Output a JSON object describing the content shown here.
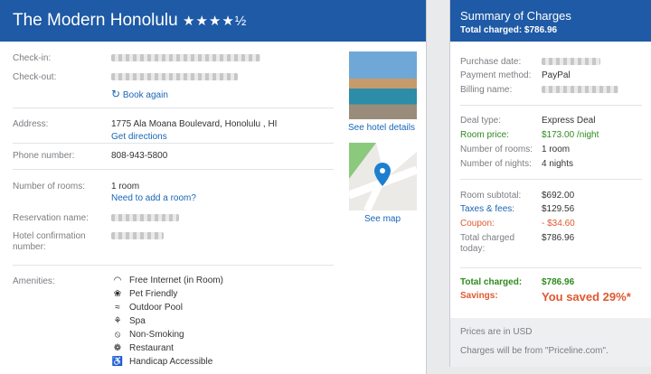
{
  "hotel": {
    "name": "The Modern Honolulu",
    "stars": "★★★★½"
  },
  "left": {
    "checkin_label": "Check-in:",
    "checkout_label": "Check-out:",
    "book_again": "Book again",
    "address_label": "Address:",
    "address": "1775 Ala Moana Boulevard, Honolulu , HI",
    "directions": "Get directions",
    "phone_label": "Phone number:",
    "phone": "808-943-5800",
    "rooms_label": "Number of rooms:",
    "rooms": "1 room",
    "add_room": "Need to add a room?",
    "reservation_label": "Reservation name:",
    "confirmation_label": "Hotel confirmation number:",
    "amenities_label": "Amenities:",
    "amenities": [
      "Free Internet (in Room)",
      "Pet Friendly",
      "Outdoor Pool",
      "Spa",
      "Non-Smoking",
      "Restaurant",
      "Handicap Accessible"
    ],
    "see_details": "See hotel details",
    "see_map": "See map"
  },
  "summary": {
    "title": "Summary of Charges",
    "total_head": "Total charged: $786.96",
    "purchase_label": "Purchase date:",
    "payment_label": "Payment method:",
    "payment": "PayPal",
    "billing_label": "Billing name:",
    "deal_label": "Deal type:",
    "deal": "Express Deal",
    "room_price_label": "Room price:",
    "room_price": "$173.00 /night",
    "num_rooms_label": "Number of rooms:",
    "num_rooms": "1 room",
    "nights_label": "Number of nights:",
    "nights": "4 nights",
    "subtotal_label": "Room subtotal:",
    "subtotal": "$692.00",
    "taxes_label": "Taxes & fees:",
    "taxes": "$129.56",
    "coupon_label": "Coupon:",
    "coupon": "- $34.60",
    "total_today_label": "Total charged today:",
    "total_today": "$786.96",
    "total_label": "Total charged:",
    "total": "$786.96",
    "savings_label": "Savings:",
    "savings": "You saved 29%*",
    "usd_note": "Prices are in USD",
    "charges_note": "Charges will be from \"Priceline.com\"."
  },
  "colors": {
    "header": "#1e5aa5",
    "link": "#1766b8",
    "green": "#2f8a1e",
    "red": "#e0582f"
  }
}
